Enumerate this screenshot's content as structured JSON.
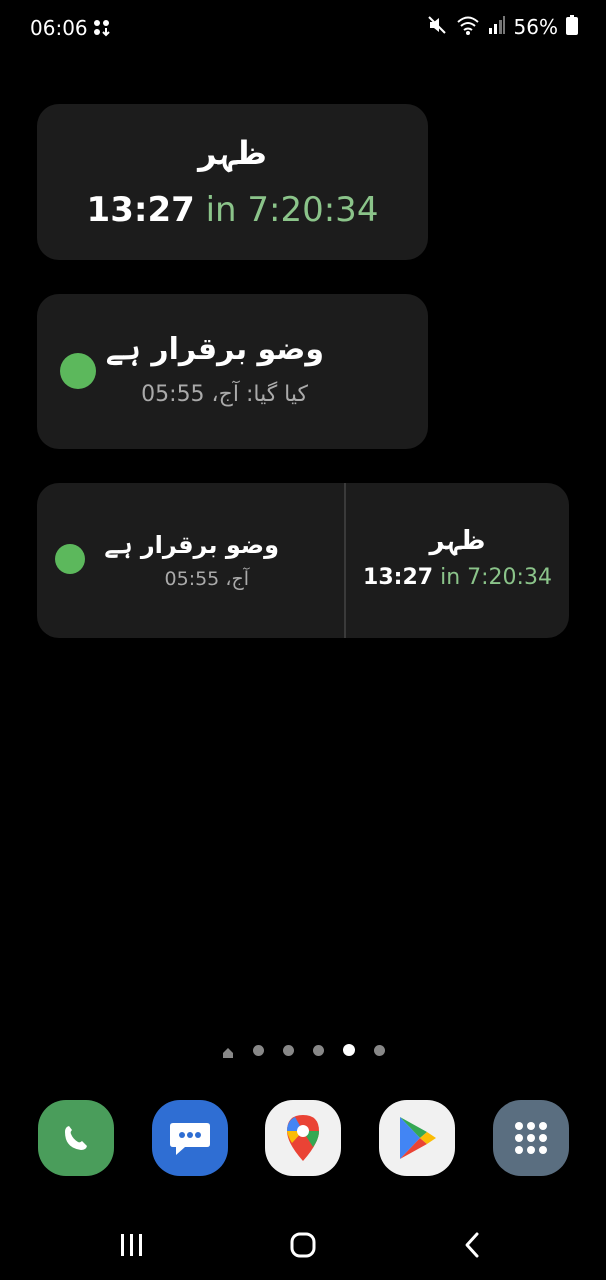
{
  "status_bar": {
    "time": "06:06",
    "battery_percent": "56%",
    "icons": [
      "notification-icon",
      "mute-icon",
      "wifi-icon",
      "signal-icon",
      "battery-icon"
    ]
  },
  "widget_prayer": {
    "prayer_name": "ظہر",
    "prayer_time": "13:27",
    "countdown": "in 7:20:34"
  },
  "widget_wudu": {
    "status": "وضو برقرار ہے",
    "performed": "کیا گیا: آج، 05:55",
    "status_color": "#5cb85c"
  },
  "widget_combined": {
    "wudu_status": "وضو برقرار ہے",
    "wudu_time": "آج، 05:55",
    "prayer_name": "ظہر",
    "prayer_time": "13:27",
    "countdown": "in 7:20:34"
  },
  "page_indicator": {
    "total": 6,
    "active_index": 4
  },
  "dock": {
    "apps": [
      "phone-app-icon",
      "messages-app-icon",
      "maps-app-icon",
      "play-store-app-icon",
      "app-drawer-icon"
    ]
  },
  "navbar": {
    "buttons": [
      "recents-button",
      "home-button",
      "back-button"
    ]
  },
  "colors": {
    "widget_bg": "#1c1c1c",
    "accent_green": "#8bc48a",
    "dot_green": "#5cb85c"
  }
}
